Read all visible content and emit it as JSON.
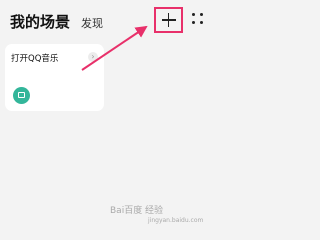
{
  "header": {
    "tab_active": "我的场景",
    "tab_discover": "发现",
    "add_icon": "plus-icon",
    "more_icon": "grid-dots-icon"
  },
  "cards": [
    {
      "title": "打开QQ音乐",
      "icon": "copy-icon",
      "icon_color": "#33b69a"
    }
  ],
  "annotation": {
    "color": "#e8306a"
  },
  "watermark": {
    "text": "Bai百度 经验",
    "sub": "jingyan.baidu.com"
  }
}
